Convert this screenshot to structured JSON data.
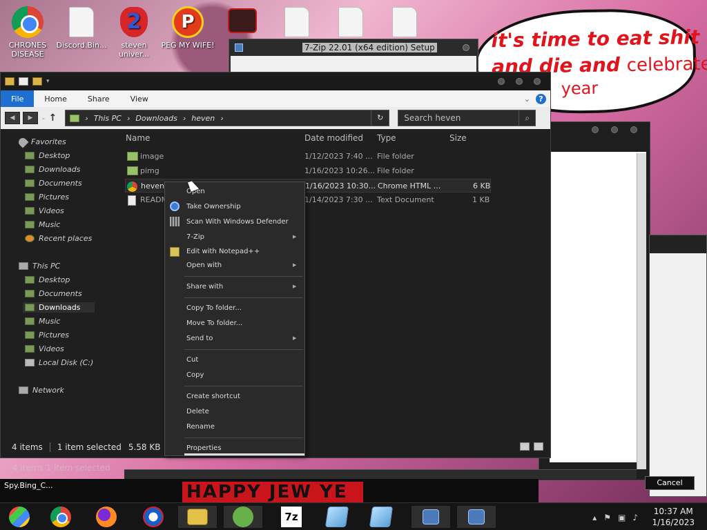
{
  "desktop": {
    "icons": [
      {
        "label": "CHRONES DISEASE"
      },
      {
        "label": "Discord.Bin..."
      },
      {
        "label": "steven univer..."
      },
      {
        "label": "PEG MY WIFE!"
      }
    ],
    "bubble": {
      "line1": "it's time to eat shit",
      "line2a": "and die and",
      "line2b": "celebrate",
      "line3": "year"
    },
    "happy": "HAPPY JEW YE",
    "spy": "Spy.Bing_C...",
    "ghost_status": "4 items  1 item selected"
  },
  "zip_window": {
    "title": "7-Zip 22.01 (x64 edition) Setup"
  },
  "cancel_label": "Cancel",
  "explorer": {
    "ribbon_tabs": [
      "File",
      "Home",
      "Share",
      "View"
    ],
    "breadcrumb": [
      "This PC",
      "Downloads",
      "heven"
    ],
    "search_placeholder": "Search heven",
    "nav": {
      "favorites": "Favorites",
      "fav_items": [
        "Desktop",
        "Downloads",
        "Documents",
        "Pictures",
        "Videos",
        "Music",
        "Recent places"
      ],
      "this_pc": "This PC",
      "pc_items": [
        "Desktop",
        "Documents",
        "Downloads",
        "Music",
        "Pictures",
        "Videos",
        "Local Disk (C:)"
      ],
      "network": "Network"
    },
    "columns": {
      "name": "Name",
      "date": "Date modified",
      "type": "Type",
      "size": "Size"
    },
    "files": [
      {
        "name": "image",
        "date": "1/12/2023 7:40 ...",
        "type": "File folder",
        "size": ""
      },
      {
        "name": "pimg",
        "date": "1/16/2023 10:26...",
        "type": "File folder",
        "size": ""
      },
      {
        "name": "heven.",
        "date": "1/16/2023 10:30...",
        "type": "Chrome HTML ...",
        "size": "6 KB"
      },
      {
        "name": "READM",
        "date": "1/14/2023 7:30 ...",
        "type": "Text Document",
        "size": "1 KB"
      }
    ],
    "status": {
      "items": "4 items",
      "selected": "1 item selected",
      "size": "5.58 KB"
    }
  },
  "context_menu": {
    "open": "Open",
    "take_ownership": "Take Ownership",
    "scan": "Scan With Windows Defender",
    "zip": "7-Zip",
    "notepad": "Edit with Notepad++",
    "open_with": "Open with",
    "share_with": "Share with",
    "copy_to": "Copy To folder...",
    "move_to": "Move To folder...",
    "send_to": "Send to",
    "cut": "Cut",
    "copy": "Copy",
    "create_shortcut": "Create shortcut",
    "delete": "Delete",
    "rename": "Rename",
    "properties": "Properties"
  },
  "taskbar": {
    "time": "10:37 AM",
    "date": "1/16/2023",
    "zip_label": "7z"
  }
}
